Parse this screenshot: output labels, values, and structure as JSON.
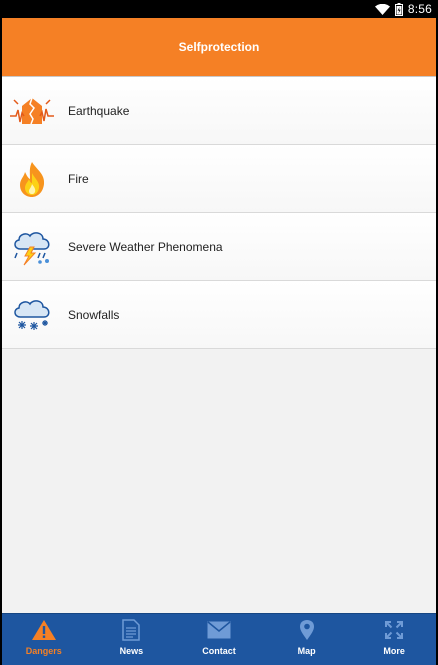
{
  "status_bar": {
    "time": "8:56"
  },
  "header": {
    "title": "Selfprotection"
  },
  "items": [
    {
      "label": "Earthquake",
      "icon": "earthquake-house-icon"
    },
    {
      "label": "Fire",
      "icon": "fire-icon"
    },
    {
      "label": "Severe Weather Phenomena",
      "icon": "storm-cloud-icon"
    },
    {
      "label": "Snowfalls",
      "icon": "snow-cloud-icon"
    }
  ],
  "tabs": [
    {
      "label": "Dangers",
      "icon": "warning-icon",
      "active": true
    },
    {
      "label": "News",
      "icon": "document-icon",
      "active": false
    },
    {
      "label": "Contact",
      "icon": "envelope-icon",
      "active": false
    },
    {
      "label": "Map",
      "icon": "map-pin-icon",
      "active": false
    },
    {
      "label": "More",
      "icon": "expand-icon",
      "active": false
    }
  ],
  "colors": {
    "header": "#f58025",
    "tab_bar": "#1e56a0",
    "tab_active": "#f58025"
  }
}
